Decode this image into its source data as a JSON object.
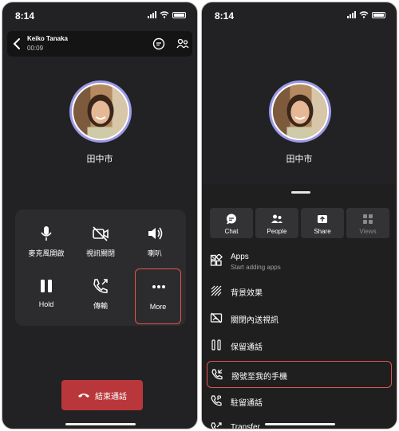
{
  "left": {
    "time": "8:14",
    "caller": {
      "name": "Keiko Tanaka",
      "timer": "00:09"
    },
    "participant_name": "田中市",
    "controls": [
      {
        "label": "麥克風開啟",
        "icon": "microphone-icon"
      },
      {
        "label": "視訊關閉",
        "icon": "camera-off-icon"
      },
      {
        "label": "喇叭",
        "icon": "speaker-icon"
      },
      {
        "label": "Hold",
        "icon": "pause-icon"
      },
      {
        "label": "傳輸",
        "icon": "phone-transfer-icon"
      },
      {
        "label": "More",
        "icon": "more-icon"
      }
    ],
    "end_call_label": "結束通話",
    "colors": {
      "highlight": "#e2554f",
      "end_call": "#b9373a",
      "avatar_ring": "#9a98e8"
    }
  },
  "right": {
    "time": "8:14",
    "participant_name": "田中市",
    "tabs": [
      {
        "label": "Chat",
        "icon": "chat-icon"
      },
      {
        "label": "People",
        "icon": "people-icon"
      },
      {
        "label": "Share",
        "icon": "share-icon"
      },
      {
        "label": "Views",
        "icon": "views-icon"
      }
    ],
    "apps": {
      "title": "Apps",
      "subtitle": "Start adding apps"
    },
    "menu": [
      {
        "label": "背景效果",
        "icon": "background-effects-icon"
      },
      {
        "label": "關閉內送視訊",
        "icon": "video-off-icon"
      },
      {
        "label": "保留通話",
        "icon": "hold-icon"
      },
      {
        "label": "撥號至我的手機",
        "icon": "phone-icon"
      },
      {
        "label": "駐留通話",
        "icon": "park-call-icon"
      },
      {
        "label": "Transfer",
        "icon": "transfer-icon"
      }
    ]
  }
}
